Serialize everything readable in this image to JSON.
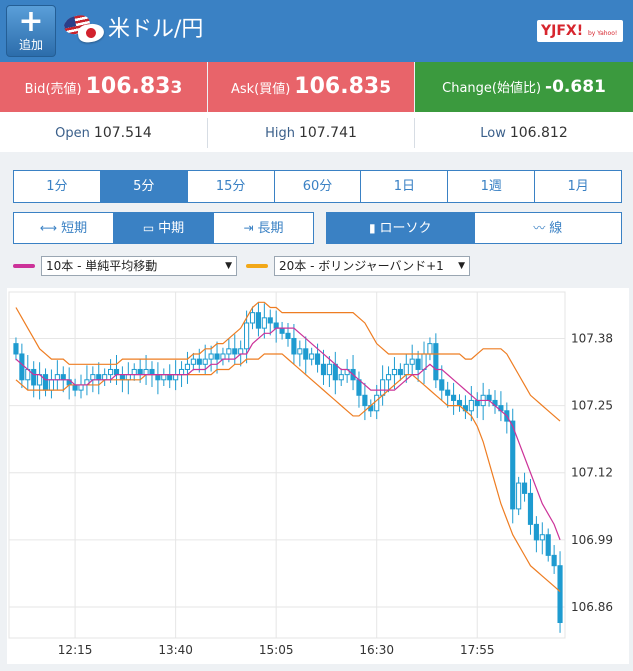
{
  "header": {
    "add_icon": "plus-icon",
    "add_label": "追加",
    "pair": "米ドル/円",
    "brand": "YJFX!",
    "brand_tail": "by Yahoo!"
  },
  "prices": {
    "bid_label": "Bid(売値)",
    "bid_main": "106.83",
    "bid_pip": "3",
    "ask_label": "Ask(買値)",
    "ask_main": "106.83",
    "ask_pip": "5",
    "change_label": "Change(始値比)",
    "change_value": "-0.681"
  },
  "ohl": {
    "open_label": "Open",
    "open_value": "107.514",
    "high_label": "High",
    "high_value": "107.741",
    "low_label": "Low",
    "low_value": "106.812"
  },
  "timeframes": [
    "1分",
    "5分",
    "15分",
    "60分",
    "1日",
    "1週",
    "1月"
  ],
  "active_timeframe": "5分",
  "terms": [
    {
      "label": "短期",
      "icon": "expand-icon"
    },
    {
      "label": "中期",
      "icon": "window-icon"
    },
    {
      "label": "長期",
      "icon": "collapse-icon"
    }
  ],
  "active_term": "中期",
  "chart_styles": [
    {
      "label": "ローソク",
      "icon": "candlestick-icon"
    },
    {
      "label": "線",
      "icon": "line-chart-icon"
    }
  ],
  "active_style": "ローソク",
  "indicators": [
    {
      "label": "10本 - 単純平均移動",
      "color": "#cc3399"
    },
    {
      "label": "20本 - ボリンジャーバンド+1",
      "color": "#f2a818"
    }
  ],
  "colors": {
    "header": "#3a81c4",
    "bid_ask": "#e8646a",
    "change": "#3b9a3e",
    "candle": "#1e9bd0",
    "ma": "#cc3399",
    "band": "#ee7d22"
  },
  "chart_data": {
    "type": "candlestick",
    "y_ticks": [
      "107.38",
      "107.25",
      "107.12",
      "106.99",
      "106.86"
    ],
    "y_tick_values": [
      107.38,
      107.25,
      107.12,
      106.99,
      106.86
    ],
    "ylim": [
      106.8,
      107.47
    ],
    "x_ticks": [
      "12:15",
      "13:40",
      "15:05",
      "16:30",
      "17:55"
    ],
    "x_tick_index": [
      10,
      27,
      44,
      61,
      78
    ],
    "candle_count": 93,
    "closes": [
      107.35,
      107.3,
      107.32,
      107.29,
      107.31,
      107.28,
      107.3,
      107.31,
      107.3,
      107.29,
      107.28,
      107.29,
      107.3,
      107.31,
      107.3,
      107.31,
      107.32,
      107.31,
      107.3,
      107.31,
      107.32,
      107.31,
      107.32,
      107.31,
      107.3,
      107.31,
      107.3,
      107.31,
      107.32,
      107.33,
      107.34,
      107.33,
      107.34,
      107.35,
      107.34,
      107.35,
      107.36,
      107.35,
      107.36,
      107.41,
      107.43,
      107.4,
      107.42,
      107.41,
      107.4,
      107.39,
      107.38,
      107.35,
      107.36,
      107.34,
      107.35,
      107.33,
      107.31,
      107.33,
      107.3,
      107.31,
      107.32,
      107.3,
      107.27,
      107.25,
      107.24,
      107.27,
      107.3,
      107.31,
      107.32,
      107.31,
      107.33,
      107.34,
      107.32,
      107.35,
      107.37,
      107.3,
      107.28,
      107.27,
      107.26,
      107.25,
      107.24,
      107.26,
      107.25,
      107.27,
      107.26,
      107.25,
      107.24,
      107.22,
      107.05,
      107.1,
      107.08,
      107.02,
      106.99,
      107.0,
      106.96,
      106.94,
      106.83
    ],
    "ma10": [
      107.34,
      107.33,
      107.32,
      107.31,
      107.31,
      107.3,
      107.3,
      107.3,
      107.3,
      107.3,
      107.29,
      107.29,
      107.29,
      107.3,
      107.3,
      107.3,
      107.3,
      107.31,
      107.31,
      107.31,
      107.31,
      107.31,
      107.31,
      107.31,
      107.31,
      107.31,
      107.31,
      107.31,
      107.31,
      107.31,
      107.32,
      107.32,
      107.32,
      107.33,
      107.33,
      107.34,
      107.34,
      107.34,
      107.35,
      107.35,
      107.37,
      107.38,
      107.39,
      107.39,
      107.4,
      107.4,
      107.4,
      107.4,
      107.39,
      107.38,
      107.37,
      107.36,
      107.35,
      107.34,
      107.33,
      107.32,
      107.32,
      107.31,
      107.3,
      107.29,
      107.28,
      107.28,
      107.28,
      107.28,
      107.28,
      107.29,
      107.3,
      107.31,
      107.31,
      107.32,
      107.33,
      107.32,
      107.32,
      107.31,
      107.3,
      107.29,
      107.28,
      107.27,
      107.26,
      107.26,
      107.26,
      107.25,
      107.24,
      107.23,
      107.21,
      107.18,
      107.15,
      107.12,
      107.09,
      107.06,
      107.04,
      107.02,
      106.99
    ],
    "band_upper": [
      107.44,
      107.42,
      107.4,
      107.38,
      107.36,
      107.35,
      107.34,
      107.34,
      107.34,
      107.33,
      107.33,
      107.33,
      107.33,
      107.33,
      107.33,
      107.33,
      107.33,
      107.33,
      107.34,
      107.34,
      107.34,
      107.34,
      107.34,
      107.34,
      107.34,
      107.34,
      107.34,
      107.34,
      107.34,
      107.34,
      107.35,
      107.35,
      107.36,
      107.36,
      107.37,
      107.37,
      107.38,
      107.39,
      107.4,
      107.42,
      107.44,
      107.45,
      107.45,
      107.44,
      107.44,
      107.43,
      107.43,
      107.43,
      107.43,
      107.43,
      107.43,
      107.43,
      107.43,
      107.43,
      107.43,
      107.43,
      107.43,
      107.43,
      107.42,
      107.41,
      107.39,
      107.37,
      107.36,
      107.35,
      107.35,
      107.35,
      107.35,
      107.35,
      107.35,
      107.35,
      107.35,
      107.35,
      107.35,
      107.35,
      107.35,
      107.35,
      107.34,
      107.34,
      107.35,
      107.36,
      107.36,
      107.36,
      107.36,
      107.35,
      107.33,
      107.31,
      107.29,
      107.27,
      107.26,
      107.25,
      107.24,
      107.23,
      107.22
    ],
    "band_lower": [
      107.3,
      107.29,
      107.28,
      107.28,
      107.28,
      107.28,
      107.28,
      107.28,
      107.28,
      107.29,
      107.29,
      107.29,
      107.29,
      107.29,
      107.29,
      107.3,
      107.3,
      107.3,
      107.3,
      107.3,
      107.3,
      107.3,
      107.31,
      107.31,
      107.31,
      107.31,
      107.31,
      107.31,
      107.31,
      107.31,
      107.31,
      107.31,
      107.31,
      107.31,
      107.32,
      107.32,
      107.32,
      107.33,
      107.33,
      107.34,
      107.34,
      107.34,
      107.35,
      107.35,
      107.35,
      107.35,
      107.34,
      107.33,
      107.32,
      107.31,
      107.3,
      107.29,
      107.28,
      107.27,
      107.26,
      107.25,
      107.24,
      107.23,
      107.23,
      107.24,
      107.25,
      107.26,
      107.27,
      107.28,
      107.29,
      107.3,
      107.31,
      107.31,
      107.3,
      107.29,
      107.28,
      107.27,
      107.26,
      107.25,
      107.25,
      107.25,
      107.24,
      107.23,
      107.21,
      107.18,
      107.14,
      107.1,
      107.06,
      107.03,
      107.0,
      106.98,
      106.96,
      106.94,
      106.93,
      106.92,
      106.91,
      106.9,
      106.89
    ]
  }
}
